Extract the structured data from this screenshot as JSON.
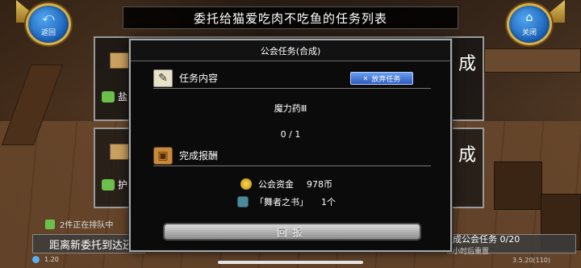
{
  "header": {
    "title": "委托给猫爱吃肉不吃鱼的任务列表",
    "back_label": "返回",
    "close_label": "关闭"
  },
  "background": {
    "card_big_text": "成",
    "card1_label": "盐",
    "card2_label": "护",
    "queue_text": "2件正在排队中",
    "time_text": "距离新委托到达还",
    "guild_task_text": "成公会任务  0/20",
    "guild_reset_text": "小时后重置",
    "bottom_left_tiny": "1.20",
    "version_text": "3.5.20(110)"
  },
  "modal": {
    "title": "公会任务(合成)",
    "task_section_label": "任务内容",
    "abandon_label": "放弃任务",
    "item_name": "魔力药Ⅲ",
    "progress": "0 / 1",
    "reward_section_label": "完成报酬",
    "rewards": [
      {
        "name": "公会资金",
        "amount": "978币",
        "icon": "coin-icon"
      },
      {
        "name": "「舞者之书」",
        "amount": "1个",
        "icon": "book-icon"
      }
    ],
    "report_label": "回报"
  },
  "colors": {
    "accent_blue": "#2b5bc0",
    "gold_border": "#d9b24a",
    "modal_bg": "#0b0b0b"
  }
}
